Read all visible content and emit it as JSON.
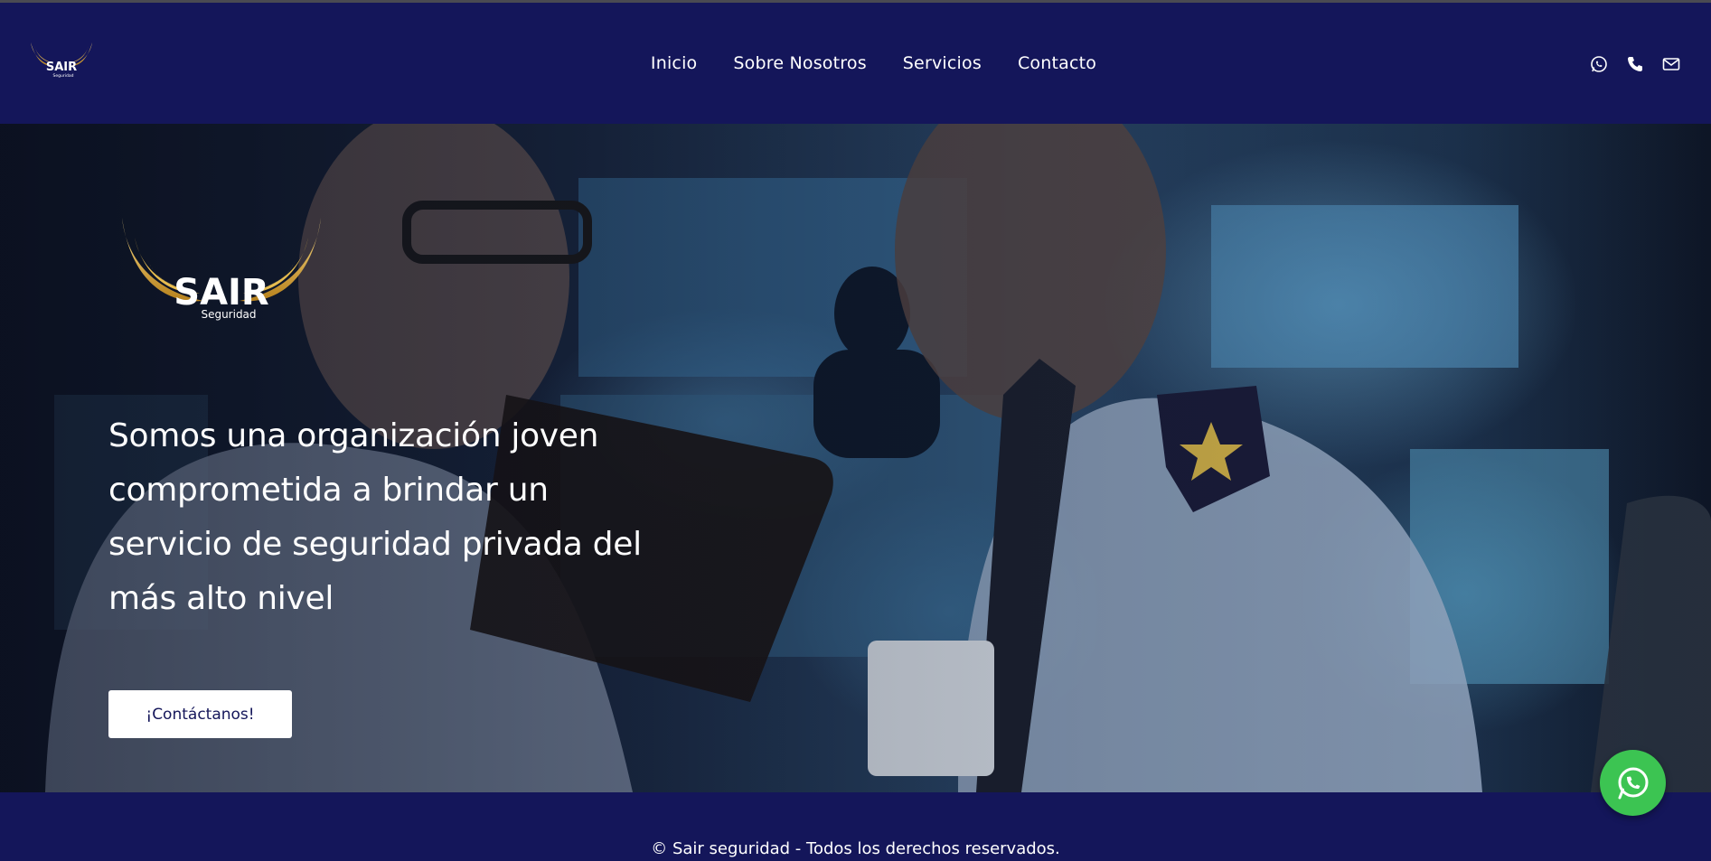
{
  "brand": {
    "logo_word": "SAIR",
    "logo_sub": "Seguridad"
  },
  "nav": {
    "items": [
      "Inicio",
      "Sobre Nosotros",
      "Servicios",
      "Contacto"
    ]
  },
  "header_icons": [
    "whatsapp-icon",
    "phone-icon",
    "mail-icon"
  ],
  "hero": {
    "heading": "Somos una organización joven comprometida a brindar un servicio de seguridad privada del más alto nivel",
    "cta_label": "¡Contáctanos!"
  },
  "footer": {
    "copyright": "© Sair seguridad - Todos los derechos reservados."
  },
  "colors": {
    "navy": "#14165a",
    "gold": "#d9a935",
    "whatsapp_green": "#3cc452"
  }
}
